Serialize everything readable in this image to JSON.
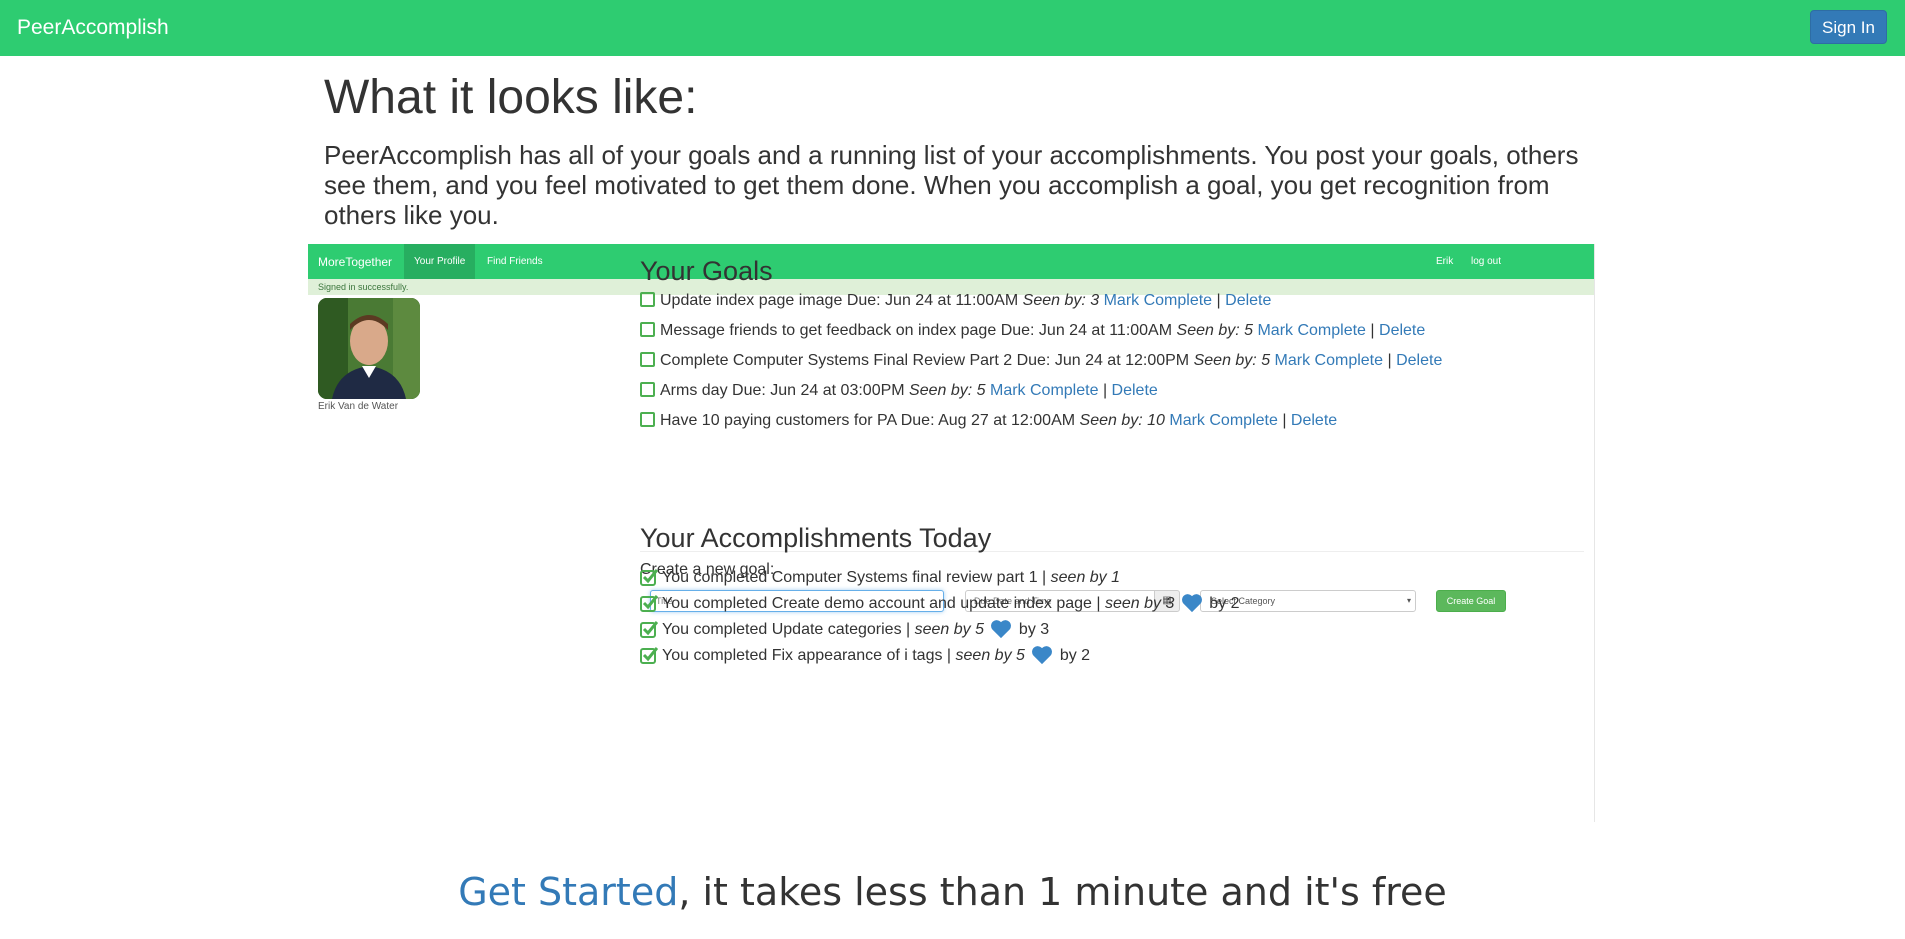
{
  "header": {
    "brand": "PeerAccomplish",
    "signin_label": "Sign In"
  },
  "main": {
    "heading": "What it looks like:",
    "lead": "PeerAccomplish has all of your goals and a running list of your accomplishments. You post your goals, others see them, and you feel motivated to get them done. When you accomplish a goal, you get recognition from others like you."
  },
  "app": {
    "brand": "MoreTogether",
    "nav": {
      "profile": "Your Profile",
      "friends": "Find Friends",
      "user": "Erik",
      "logout": "log out"
    },
    "alert": "Signed in successfully.",
    "profile_name": "Erik Van de Water",
    "goals_title": "Your Goals",
    "goals": [
      {
        "title": "Update index page image",
        "due": "Due: Jun 24 at 11:00AM",
        "seen": "Seen by: 3",
        "complete": "Mark Complete",
        "sep": "|",
        "delete": "Delete"
      },
      {
        "title": "Message friends to get feedback on index page",
        "due": "Due: Jun 24 at 11:00AM",
        "seen": "Seen by: 5",
        "complete": "Mark Complete",
        "sep": "|",
        "delete": "Delete"
      },
      {
        "title": "Complete Computer Systems Final Review Part 2",
        "due": "Due: Jun 24 at 12:00PM",
        "seen": "Seen by: 5",
        "complete": "Mark Complete",
        "sep": "|",
        "delete": "Delete"
      },
      {
        "title": "Arms day",
        "due": "Due: Jun 24 at 03:00PM",
        "seen": "Seen by: 5",
        "complete": "Mark Complete",
        "sep": "|",
        "delete": "Delete"
      },
      {
        "title": "Have 10 paying customers for PA",
        "due": "Due: Aug 27 at 12:00AM",
        "seen": "Seen by: 10",
        "complete": "Mark Complete",
        "sep": "|",
        "delete": "Delete"
      }
    ],
    "create": {
      "label": "Create a new goal:",
      "title_placeholder": "Title",
      "date_placeholder": "Due Date and Time",
      "category": "Select Category",
      "button": "Create Goal"
    },
    "acc_title": "Your Accomplishments Today",
    "accomplishments": [
      {
        "text": "You completed Computer Systems final review part 1 |",
        "seen": "seen by 1",
        "likes": ""
      },
      {
        "text": "You completed Create demo account and update index page |",
        "seen": "seen by 3",
        "likes": "by 2"
      },
      {
        "text": "You completed Update categories |",
        "seen": "seen by 5",
        "likes": "by 3"
      },
      {
        "text": "You completed Fix appearance of i tags |",
        "seen": "seen by 5",
        "likes": "by 2"
      }
    ]
  },
  "cta": {
    "link": "Get Started",
    "rest": ", it takes less than 1 minute and it's free"
  },
  "colors": {
    "brand_green": "#2ecc71",
    "link_blue": "#337ab7",
    "success_green": "#5cb85c"
  }
}
